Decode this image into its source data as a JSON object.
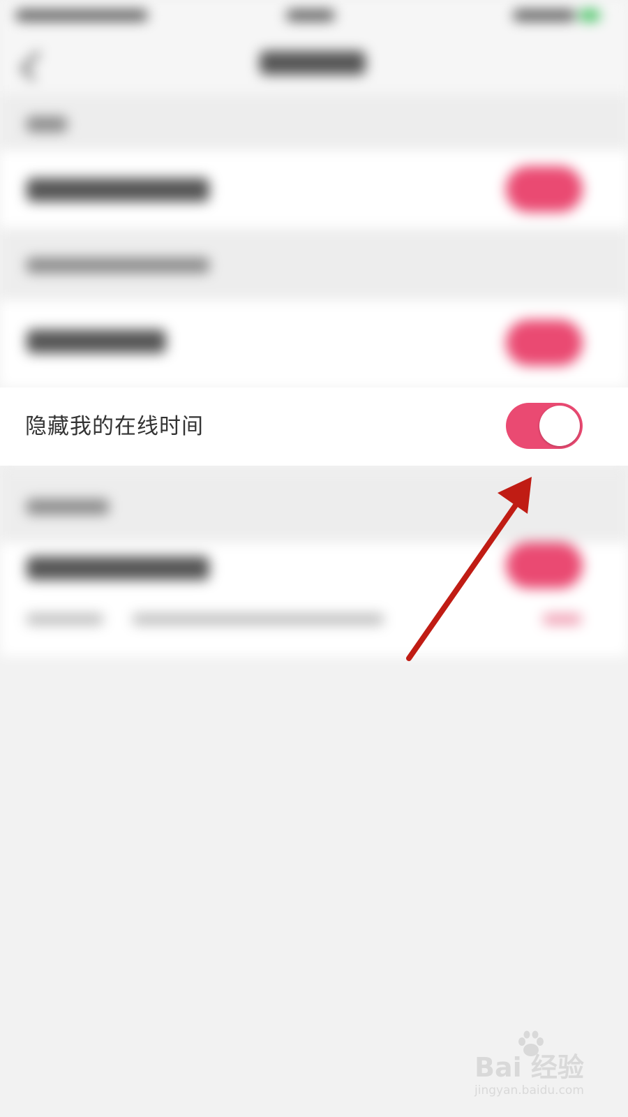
{
  "settings": {
    "hide_online_time": {
      "label": "隐藏我的在线时间",
      "enabled": true
    }
  },
  "colors": {
    "toggle_on": "#ea4a72",
    "annotation_arrow": "#c01c14",
    "background": "#f2f2f2"
  },
  "watermark": {
    "logo_text": "Bai  经验",
    "url": "jingyan.baidu.com"
  },
  "icons": {
    "back": "chevron-left-icon",
    "watermark_paw": "baidu-paw-icon"
  }
}
